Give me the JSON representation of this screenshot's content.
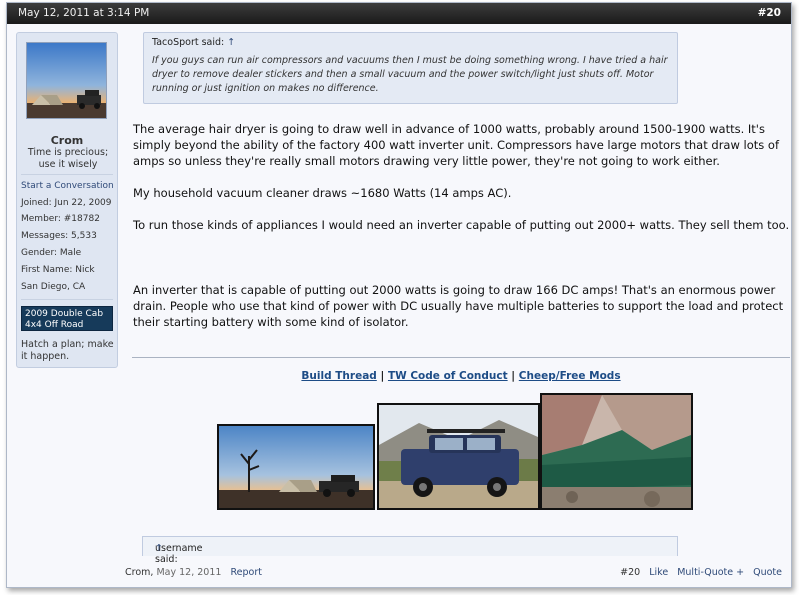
{
  "post": {
    "datetime": "May 12, 2011 at 3:14 PM",
    "number": "#20"
  },
  "user": {
    "name": "Crom",
    "title": "Time is precious; use it wisely",
    "start_conversation": "Start a Conversation",
    "joined": "Joined:  Jun 22, 2009",
    "member": "Member: #18782",
    "messages": "Messages: 5,533",
    "gender": "Gender: Male",
    "first_name": "First Name: Nick",
    "location": "San Diego, CA",
    "vehicle": "2009 Double Cab 4x4 Off Road",
    "motto": "Hatch a plan; make it happen."
  },
  "quote": {
    "author_said": "TacoSport said:",
    "arrow": "↑",
    "text": "If you guys can run air compressors and vacuums then I must be doing something wrong. I have tried a hair dryer to remove dealer stickers and then a small vacuum and the power switch/light just shuts off. Motor running or just ignition on makes no difference."
  },
  "message": {
    "p1": "The average hair dryer is going to draw well in advance of 1000 watts, probably around 1500-1900 watts. It's simply beyond the ability of the factory 400 watt inverter unit. Compressors have large motors that draw lots of amps so unless they're really small motors drawing very little power, they're not going to work either.",
    "p2": "My household vacuum cleaner draws ~1680 Watts (14 amps AC).",
    "p3": "To run those kinds of appliances I would need an inverter capable of putting out 2000+ watts. They sell them too.",
    "p4": "An inverter that is capable of putting out 2000 watts is going to draw 166 DC amps! That's an enormous power drain. People who use that kind of power with DC usually have multiple batteries to support the load and protect their starting battery with some kind of isolator."
  },
  "signature": {
    "link1": "Build Thread",
    "link2": "TW Code of Conduct",
    "link3": "Cheep/Free Mods",
    "sep": "|"
  },
  "quote2": {
    "author_said": "username said:",
    "arrow": "↑"
  },
  "footer": {
    "author": "Crom",
    "date": "May 12, 2011",
    "report": "Report",
    "number": "#20",
    "like": "Like",
    "multiquote": "Multi-Quote +",
    "quote": "Quote"
  },
  "colors": {
    "header_bg": "#1f1f1f",
    "link": "#1d4c86",
    "sidebar_bg": "#dfe6f2",
    "badge_bg": "#163a5a"
  }
}
